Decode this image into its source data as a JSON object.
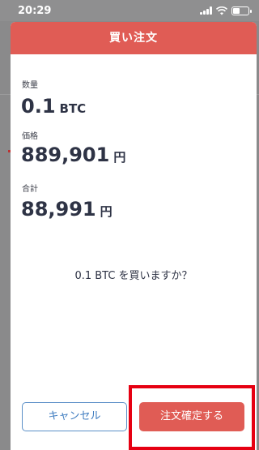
{
  "status_bar": {
    "time": "20:29"
  },
  "modal": {
    "title": "買い注文",
    "fields": [
      {
        "label": "数量",
        "value": "0.1",
        "unit": "BTC"
      },
      {
        "label": "価格",
        "value": "889,901",
        "unit": "円"
      },
      {
        "label": "合計",
        "value": "88,991",
        "unit": "円"
      }
    ],
    "confirm_message": "0.1 BTC を買いますか？",
    "cancel_label": "キャンセル",
    "confirm_label": "注文確定する"
  },
  "colors": {
    "accent": "#e05c55",
    "cancel_border": "#5b8fc7",
    "highlight": "#e60012"
  }
}
